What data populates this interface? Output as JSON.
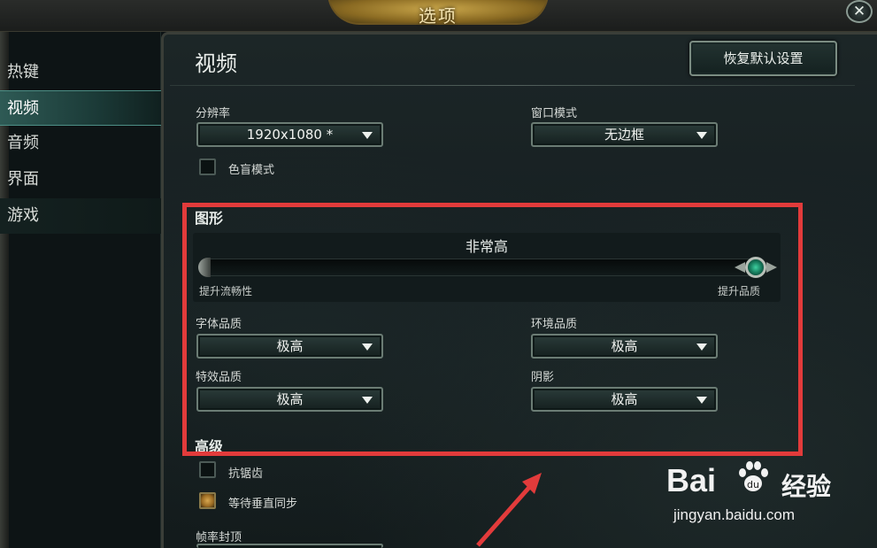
{
  "window": {
    "title": "选项",
    "close_icon": "close-icon"
  },
  "sidebar": {
    "items": [
      {
        "label": "热键",
        "active": false
      },
      {
        "label": "视频",
        "active": true
      },
      {
        "label": "音频",
        "active": false
      },
      {
        "label": "界面",
        "active": false
      },
      {
        "label": "游戏",
        "active": false
      }
    ]
  },
  "main": {
    "title": "视频",
    "reset_button": "恢复默认设置",
    "resolution": {
      "label": "分辨率",
      "value": "1920x1080 *"
    },
    "window_mode": {
      "label": "窗口模式",
      "value": "无边框"
    },
    "colorblind": {
      "label": "色盲模式",
      "checked": false
    },
    "graphics": {
      "section": "图形",
      "quality_value": "非常高",
      "slider_min_label": "提升流畅性",
      "slider_max_label": "提升品质",
      "slider_level": 1.0,
      "font_quality": {
        "label": "字体品质",
        "value": "极高"
      },
      "environment_quality": {
        "label": "环境品质",
        "value": "极高"
      },
      "effects_quality": {
        "label": "特效品质",
        "value": "极高"
      },
      "shadows": {
        "label": "阴影",
        "value": "极高"
      }
    },
    "advanced": {
      "section": "高级",
      "antialiasing": {
        "label": "抗锯齿",
        "checked": false
      },
      "vsync": {
        "label": "等待垂直同步",
        "checked": true
      },
      "frame_cap": {
        "label": "帧率封顶"
      }
    }
  },
  "watermark": {
    "brand": "Bai",
    "brand_suffix": "经验",
    "url": "jingyan.baidu.com"
  },
  "colors": {
    "accent_teal": "#2e5a55",
    "annotation_red": "#e23b3b",
    "title_gold": "#c9a64a"
  }
}
